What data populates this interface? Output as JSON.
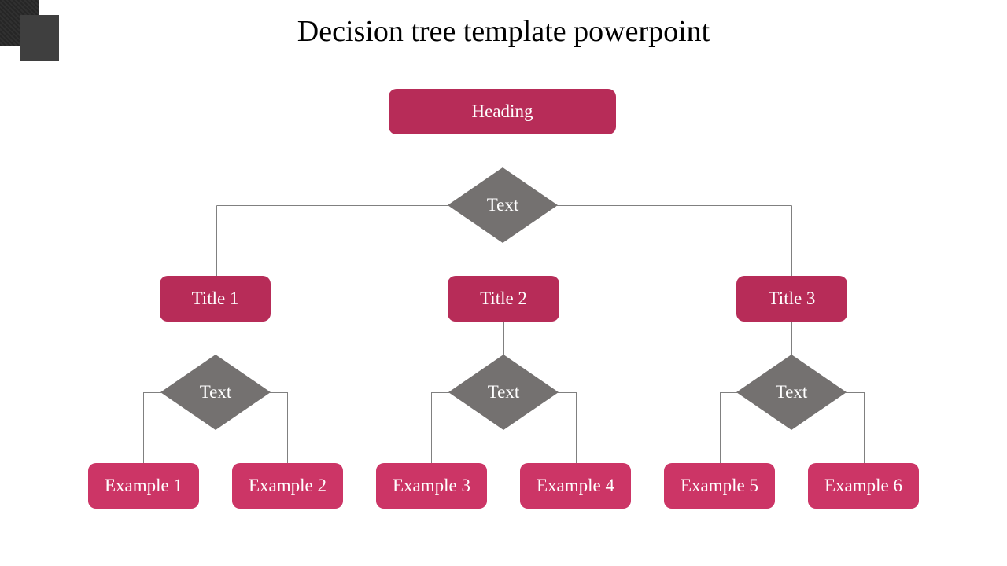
{
  "slide": {
    "title": "Decision tree template powerpoint"
  },
  "colors": {
    "primary_box": "#b72c58",
    "secondary_box": "#cc3566",
    "diamond": "#747170",
    "connector": "#808080"
  },
  "tree": {
    "heading": "Heading",
    "root_decision": "Text",
    "titles": [
      {
        "label": "Title 1",
        "decision": "Text",
        "examples": [
          "Example 1",
          "Example 2"
        ]
      },
      {
        "label": "Title 2",
        "decision": "Text",
        "examples": [
          "Example 3",
          "Example 4"
        ]
      },
      {
        "label": "Title 3",
        "decision": "Text",
        "examples": [
          "Example 5",
          "Example 6"
        ]
      }
    ]
  }
}
